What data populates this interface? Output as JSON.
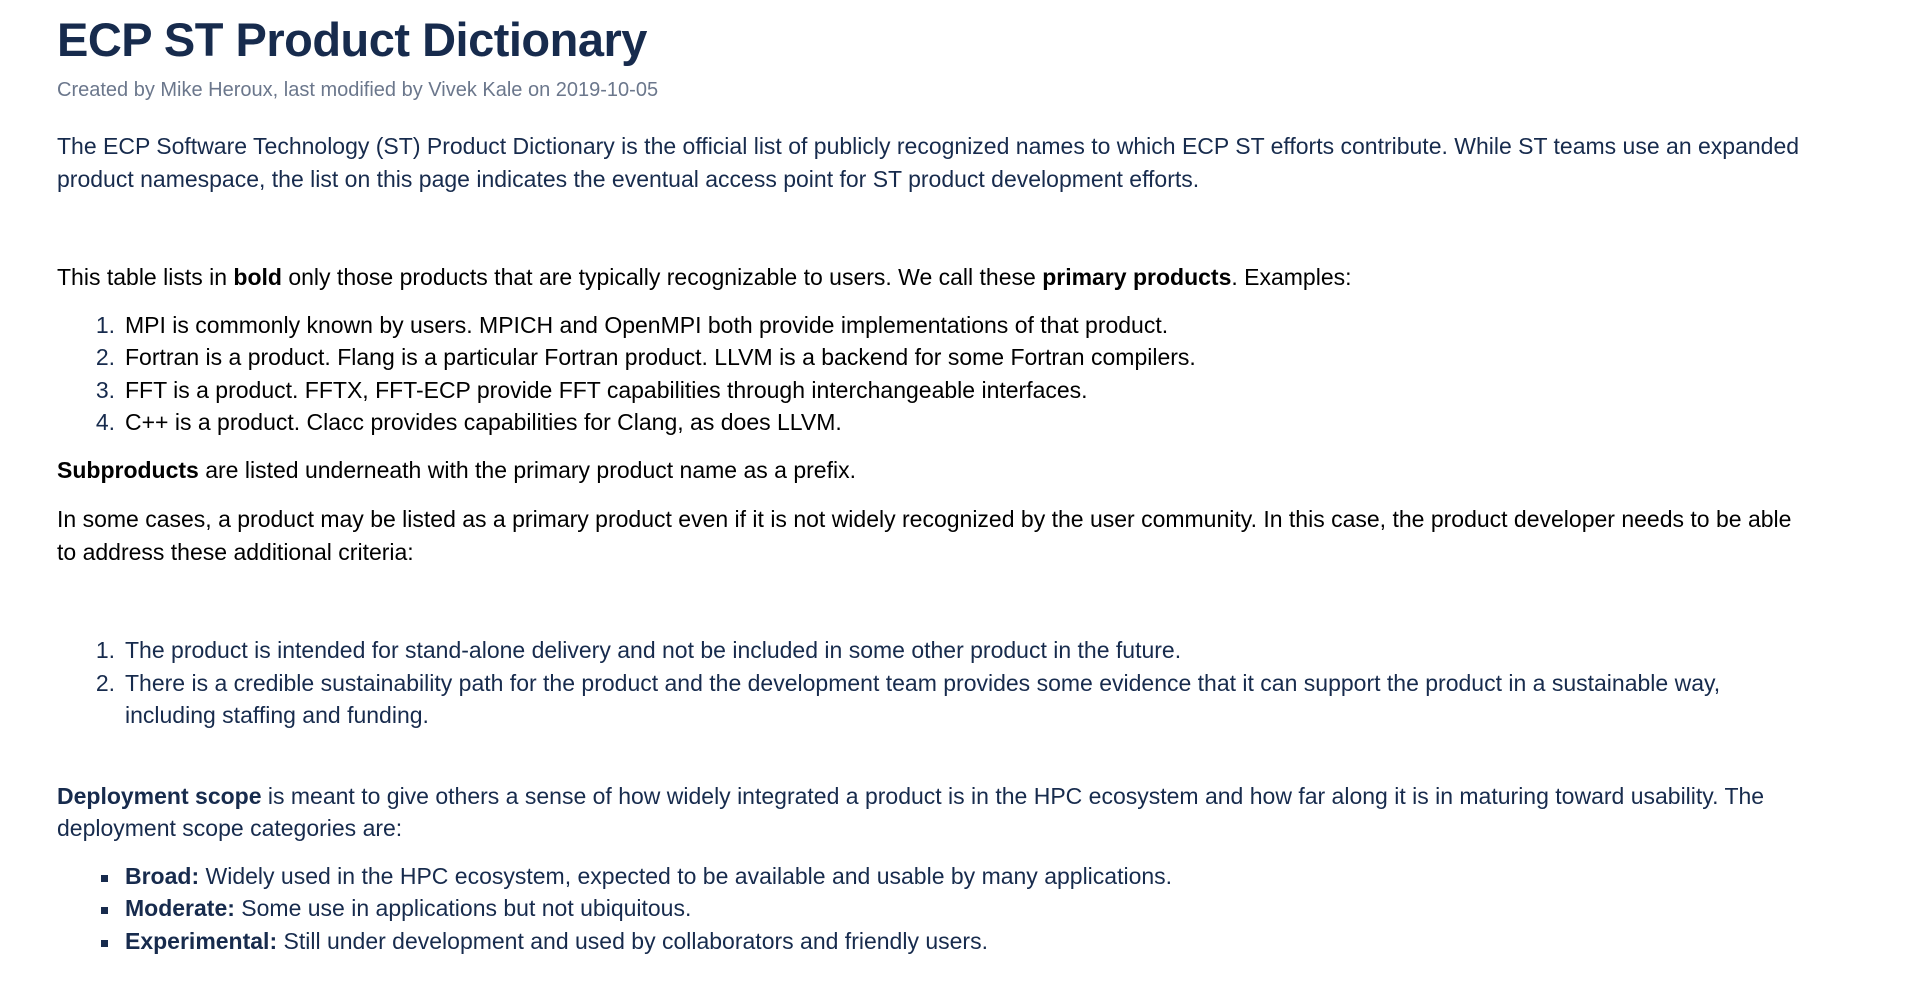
{
  "title": "ECP ST Product Dictionary",
  "byline": "Created by Mike Heroux, last modified by Vivek Kale on 2019-10-05",
  "intro": {
    "line1": "The ECP Software Technology (ST) Product Dictionary is the official list of publicly recognized names to which ECP ST efforts contribute.  While ST teams use an expanded",
    "line2": "product namespace, the list on this page indicates the eventual access point for ST product development efforts."
  },
  "table_para": {
    "t1": "This table lists in ",
    "b1": "bold",
    "t2": " only those products that are typically recognizable to users.  We call these ",
    "b2": "primary products",
    "t3": ". Examples:"
  },
  "examples": [
    {
      "num": "1.",
      "text": "MPI is commonly known by users. MPICH and OpenMPI both provide implementations of that product."
    },
    {
      "num": "2.",
      "text": "Fortran is a product. Flang is a particular Fortran product. LLVM is a backend for some Fortran compilers."
    },
    {
      "num": "3.",
      "text": "FFT is a product. FFTX, FFT-ECP provide FFT capabilities through interchangeable interfaces."
    },
    {
      "num": "4.",
      "text": "C++ is a product. Clacc provides capabilities for Clang, as does LLVM."
    }
  ],
  "subproducts": {
    "bold": "Subproducts",
    "text": " are listed underneath with the primary product name as a prefix."
  },
  "cases": {
    "line1": "In some cases, a product may be listed as a primary product even if it is not widely recognized by the user community.  In this case, the product developer needs to be able",
    "line2": "to address these additional criteria:"
  },
  "criteria": [
    {
      "num": "1.",
      "line1": "The product is intended for stand-alone delivery and not be included in some other product in the future.",
      "line2": ""
    },
    {
      "num": "2.",
      "line1": "There is a credible sustainability path for the product and the development team provides some evidence that it can support the product in a sustainable way,",
      "line2": "including staffing and funding."
    }
  ],
  "deployment": {
    "bold": "Deployment scope",
    "line1": " is meant to give others a sense of how widely integrated a product is in the HPC ecosystem and how far along it is in maturing toward usability.  The",
    "line2": "deployment scope categories are:"
  },
  "scopes": [
    {
      "term": "Broad:",
      "text": " Widely used in the HPC ecosystem, expected to be available and usable by many applications."
    },
    {
      "term": "Moderate:",
      "text": " Some use in applications but not ubiquitous."
    },
    {
      "term": "Experimental:",
      "text": " Still under development and used by collaborators and friendly users."
    }
  ]
}
